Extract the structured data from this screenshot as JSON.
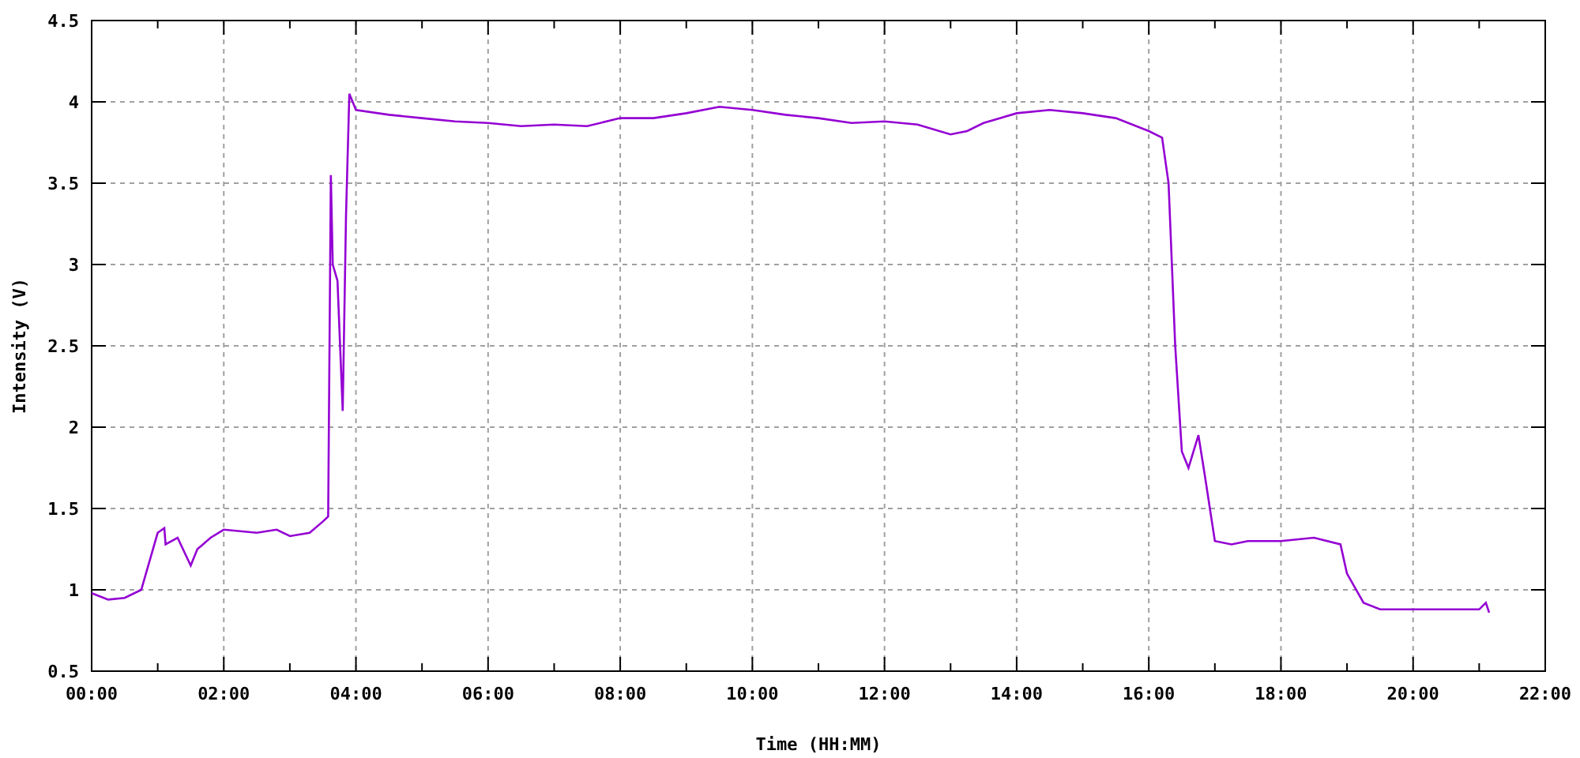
{
  "chart_data": {
    "type": "line",
    "grid": true,
    "xlabel": "Time (HH:MM)",
    "ylabel": "Intensity (V)",
    "xlim": [
      0,
      22
    ],
    "ylim": [
      0.5,
      4.5
    ],
    "xticks": [
      {
        "value": 0,
        "label": "00:00"
      },
      {
        "value": 2,
        "label": "02:00"
      },
      {
        "value": 4,
        "label": "04:00"
      },
      {
        "value": 6,
        "label": "06:00"
      },
      {
        "value": 8,
        "label": "08:00"
      },
      {
        "value": 10,
        "label": "10:00"
      },
      {
        "value": 12,
        "label": "12:00"
      },
      {
        "value": 14,
        "label": "14:00"
      },
      {
        "value": 16,
        "label": "16:00"
      },
      {
        "value": 18,
        "label": "18:00"
      },
      {
        "value": 20,
        "label": "20:00"
      },
      {
        "value": 22,
        "label": "22:00"
      }
    ],
    "yticks": [
      {
        "value": 0.5,
        "label": "0.5"
      },
      {
        "value": 1,
        "label": "1"
      },
      {
        "value": 1.5,
        "label": "1.5"
      },
      {
        "value": 2,
        "label": "2"
      },
      {
        "value": 2.5,
        "label": "2.5"
      },
      {
        "value": 3,
        "label": "3"
      },
      {
        "value": 3.5,
        "label": "3.5"
      },
      {
        "value": 4,
        "label": "4"
      },
      {
        "value": 4.5,
        "label": "4.5"
      }
    ],
    "x": [
      0,
      0.25,
      0.5,
      0.75,
      1.0,
      1.1,
      1.12,
      1.3,
      1.5,
      1.6,
      1.8,
      2.0,
      2.5,
      2.8,
      3.0,
      3.3,
      3.5,
      3.58,
      3.62,
      3.65,
      3.72,
      3.8,
      3.85,
      3.9,
      4.0,
      4.5,
      5,
      5.5,
      6,
      6.5,
      7,
      7.5,
      8,
      8.5,
      9,
      9.5,
      10,
      10.5,
      11,
      11.5,
      12,
      12.5,
      13,
      13.25,
      13.5,
      14,
      14.5,
      15,
      15.5,
      16,
      16.2,
      16.3,
      16.4,
      16.5,
      16.6,
      16.75,
      16.85,
      17.0,
      17.25,
      17.5,
      18,
      18.5,
      18.9,
      19.0,
      19.25,
      19.5,
      20,
      20.5,
      21,
      21.1,
      21.15
    ],
    "series": [
      {
        "color": "#9400d3",
        "values": [
          0.98,
          0.94,
          0.95,
          1.0,
          1.35,
          1.38,
          1.28,
          1.32,
          1.15,
          1.25,
          1.32,
          1.37,
          1.35,
          1.37,
          1.33,
          1.35,
          1.42,
          1.45,
          3.55,
          3.0,
          2.9,
          2.1,
          3.3,
          4.05,
          3.95,
          3.92,
          3.9,
          3.88,
          3.87,
          3.85,
          3.86,
          3.85,
          3.9,
          3.9,
          3.93,
          3.97,
          3.95,
          3.92,
          3.9,
          3.87,
          3.88,
          3.86,
          3.8,
          3.82,
          3.87,
          3.93,
          3.95,
          3.93,
          3.9,
          3.82,
          3.78,
          3.5,
          2.5,
          1.85,
          1.75,
          1.95,
          1.7,
          1.3,
          1.28,
          1.3,
          1.3,
          1.32,
          1.28,
          1.1,
          0.92,
          0.88,
          0.88,
          0.88,
          0.88,
          0.92,
          0.86
        ]
      }
    ]
  }
}
